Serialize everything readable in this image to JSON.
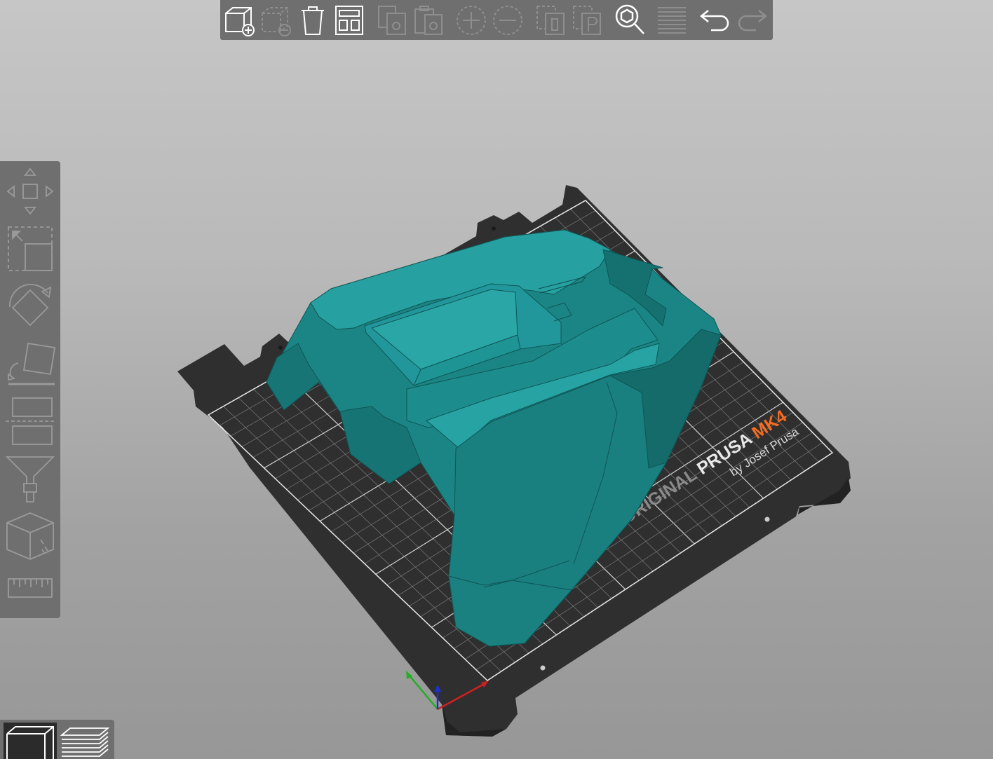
{
  "app": "PrusaSlicer",
  "top_toolbar": {
    "items": [
      {
        "id": "add",
        "icon": "add-object-icon",
        "enabled": true
      },
      {
        "id": "delete",
        "icon": "delete-object-icon",
        "enabled": false
      },
      {
        "id": "delete_all",
        "icon": "delete-all-icon",
        "enabled": true
      },
      {
        "id": "arrange",
        "icon": "arrange-icon",
        "enabled": true
      },
      {
        "id": "copy",
        "icon": "copy-icon",
        "enabled": false
      },
      {
        "id": "paste",
        "icon": "paste-icon",
        "enabled": false
      },
      {
        "id": "add_instance",
        "icon": "add-instance-icon",
        "enabled": false
      },
      {
        "id": "remove_instance",
        "icon": "remove-instance-icon",
        "enabled": false
      },
      {
        "id": "split_objects",
        "icon": "split-objects-icon",
        "enabled": false
      },
      {
        "id": "split_parts",
        "icon": "split-parts-icon",
        "enabled": false
      },
      {
        "id": "search",
        "icon": "search-icon",
        "enabled": true
      },
      {
        "id": "layer_editing",
        "icon": "layer-editing-icon",
        "enabled": false
      },
      {
        "id": "undo",
        "icon": "undo-icon",
        "enabled": true
      },
      {
        "id": "redo",
        "icon": "redo-icon",
        "enabled": false
      }
    ]
  },
  "left_toolbar": {
    "items": [
      {
        "id": "move",
        "icon": "move-icon"
      },
      {
        "id": "scale",
        "icon": "scale-icon"
      },
      {
        "id": "rotate",
        "icon": "rotate-icon"
      },
      {
        "id": "place_on_face",
        "icon": "place-on-face-icon"
      },
      {
        "id": "cut",
        "icon": "cut-icon"
      },
      {
        "id": "paint_supports",
        "icon": "paint-supports-icon"
      },
      {
        "id": "seam_painting",
        "icon": "seam-painting-icon"
      },
      {
        "id": "measure",
        "icon": "measure-icon"
      }
    ]
  },
  "view_toggle": {
    "items": [
      {
        "id": "3d",
        "icon": "3d-view-icon",
        "active": true
      },
      {
        "id": "preview",
        "icon": "preview-layers-icon",
        "active": false
      }
    ]
  },
  "bed": {
    "logo_line1_prefix": "ORIGINAL ",
    "logo_line1_brand": "PRUSA ",
    "logo_line1_model": "MK4",
    "logo_line2": "by Josef Prusa"
  },
  "colors": {
    "toolbar_bg": "#6f6f6f",
    "icon_enabled": "#ffffff",
    "icon_disabled": "#8e8e8e",
    "bed": "#2f2f2f",
    "model": "#1f8f8f",
    "model_accent": "#30a8a8",
    "model_shadow": "#136565",
    "prusa_orange": "#f36c21",
    "axis_x": "#d02020",
    "axis_y": "#20b020",
    "axis_z": "#2030d0"
  }
}
